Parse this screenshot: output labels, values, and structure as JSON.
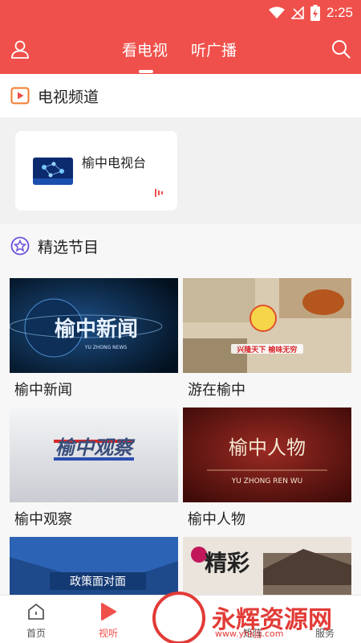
{
  "status_bar": {
    "time": "2:25"
  },
  "top_nav": {
    "tabs": [
      {
        "label": "看电视",
        "active": true
      },
      {
        "label": "听广播",
        "active": false
      }
    ]
  },
  "tv_section": {
    "title": "电视频道",
    "channels": [
      {
        "name": "榆中电视台"
      }
    ]
  },
  "featured_section": {
    "title": "精选节目",
    "programs": [
      {
        "title": "榆中新闻",
        "thumb_text": "榆中新闻",
        "thumb_sub": "YU ZHONG NEWS"
      },
      {
        "title": "游在榆中",
        "thumb_text": "兴隆天下  榆味无穷",
        "thumb_sub": "游在榆中"
      },
      {
        "title": "榆中观察",
        "thumb_text": "榆中观察"
      },
      {
        "title": "榆中人物",
        "thumb_text": "榆中人物",
        "thumb_sub": "YU ZHONG REN WU"
      },
      {
        "title": "",
        "thumb_text": "政策面对面"
      },
      {
        "title": "",
        "thumb_text": "精彩"
      }
    ]
  },
  "bottom_nav": {
    "items": [
      {
        "label": "首页",
        "icon": "home-icon",
        "active": false
      },
      {
        "label": "视听",
        "icon": "play-icon",
        "active": true
      },
      {
        "label": "矩阵",
        "icon": "matrix-icon",
        "active": false
      },
      {
        "label": "服务",
        "icon": "service-icon",
        "active": false
      }
    ]
  },
  "watermark": {
    "text": "永辉资源网",
    "url": "www.yhkjjj.com"
  },
  "colors": {
    "brand": "#f0504b",
    "accent_purple": "#6b4fd6",
    "text": "#222222"
  }
}
